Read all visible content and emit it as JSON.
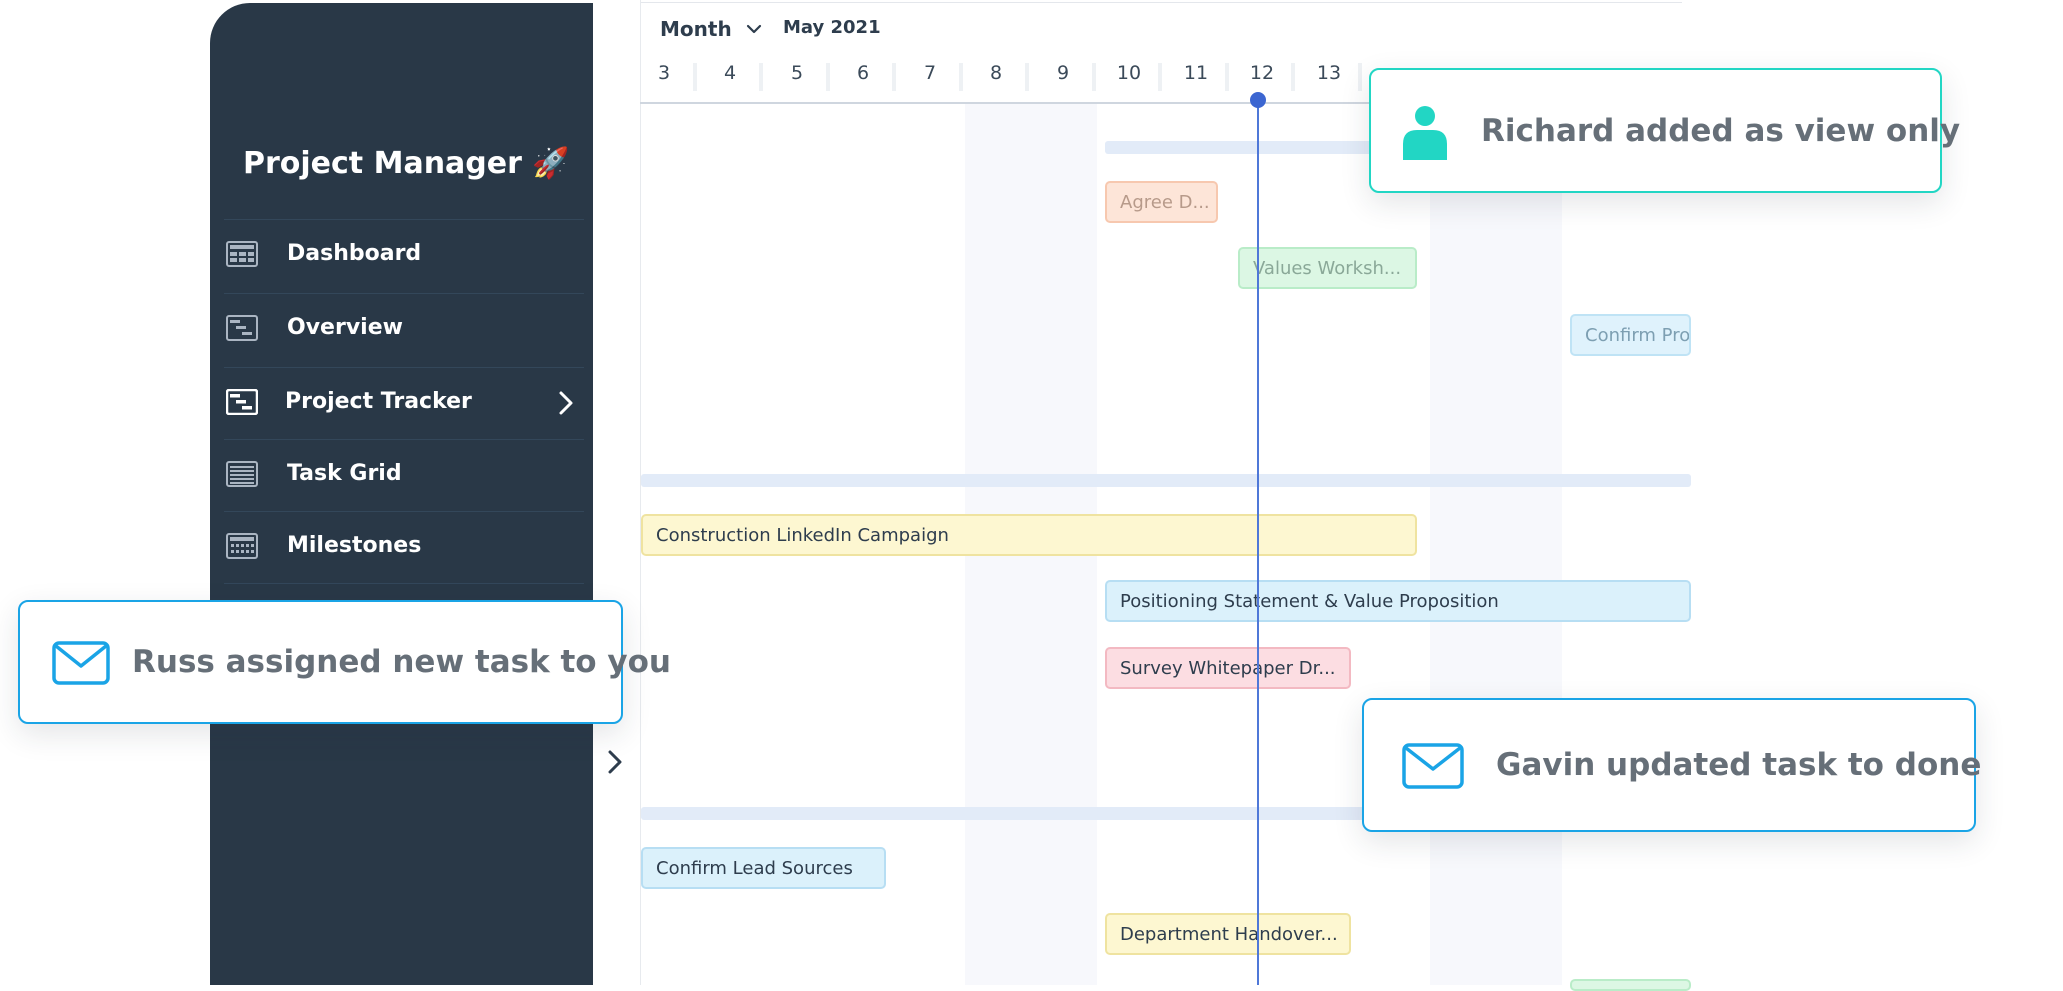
{
  "app": {
    "title": "Project Manager 🚀"
  },
  "sidebar": {
    "items": [
      {
        "label": "Dashboard",
        "icon": "dashboard-icon"
      },
      {
        "label": "Overview",
        "icon": "overview-icon"
      },
      {
        "label": "Project Tracker",
        "icon": "project-tracker-icon",
        "has_chevron": true
      },
      {
        "label": "Task Grid",
        "icon": "task-grid-icon"
      },
      {
        "label": "Milestones",
        "icon": "milestones-icon"
      }
    ]
  },
  "timeline": {
    "view": "Month",
    "period": "May 2021",
    "days": [
      "3",
      "4",
      "5",
      "6",
      "7",
      "8",
      "9",
      "10",
      "11",
      "12",
      "13"
    ],
    "today": "12"
  },
  "tasks": [
    {
      "label": "Agree D..."
    },
    {
      "label": "Values Worksh..."
    },
    {
      "label": "Confirm Pro"
    },
    {
      "label": "Construction LinkedIn Campaign"
    },
    {
      "label": "Positioning Statement & Value Proposition"
    },
    {
      "label": "Survey Whitepaper Dr..."
    },
    {
      "label": "Confirm Lead Sources"
    },
    {
      "label": "Department Handover..."
    }
  ],
  "notifications": {
    "richard": {
      "text": "Richard added as view only",
      "icon": "user-icon",
      "color": "#22d6c4"
    },
    "russ": {
      "text": "Russ assigned new task to you",
      "icon": "mail-icon",
      "color": "#1aa4e6"
    },
    "gavin": {
      "text": "Gavin updated task to done",
      "icon": "mail-icon",
      "color": "#1aa4e6"
    }
  },
  "colors": {
    "sidebar_bg": "#293847",
    "today_line": "#4f78d8"
  }
}
